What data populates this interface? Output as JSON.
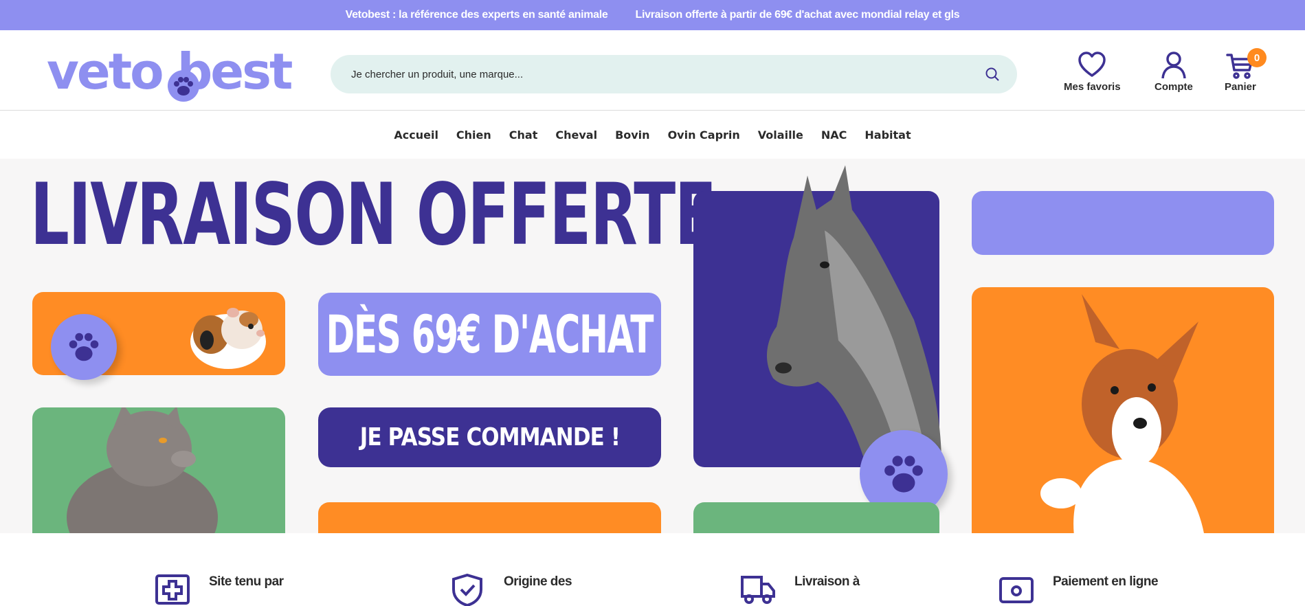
{
  "topbar": {
    "message_1": "Vetobest : la référence des experts en santé animale",
    "message_2": "Livraison offerte à partir de 69€ d'achat avec mondial relay et gls"
  },
  "header": {
    "logo_text": "veto best",
    "search": {
      "placeholder": "Je chercher un produit, une marque..."
    },
    "favorites_label": "Mes favoris",
    "account_label": "Compte",
    "cart_label": "Panier",
    "cart_count": "0"
  },
  "nav": {
    "items": [
      "Accueil",
      "Chien",
      "Chat",
      "Cheval",
      "Bovin",
      "Ovin Caprin",
      "Volaille",
      "NAC",
      "Habitat"
    ]
  },
  "hero": {
    "title": "LIVRAISON OFFERTE",
    "price_line": "DÈS 69€ D'ACHAT",
    "cta_label": "JE PASSE COMMANDE !"
  },
  "features": {
    "items": [
      "Site tenu par",
      "Origine des",
      "Livraison à",
      "Paiement en ligne"
    ]
  },
  "colors": {
    "lavender": "#8e8ff0",
    "navy": "#3d3193",
    "orange": "#ff8c24",
    "green": "#6bb57d",
    "search_bg": "#e2f1ef"
  },
  "icons": [
    "search-icon",
    "heart-icon",
    "user-icon",
    "cart-icon",
    "paw-icon",
    "medical-cross-icon",
    "shield-check-icon",
    "truck-icon",
    "card-icon"
  ]
}
